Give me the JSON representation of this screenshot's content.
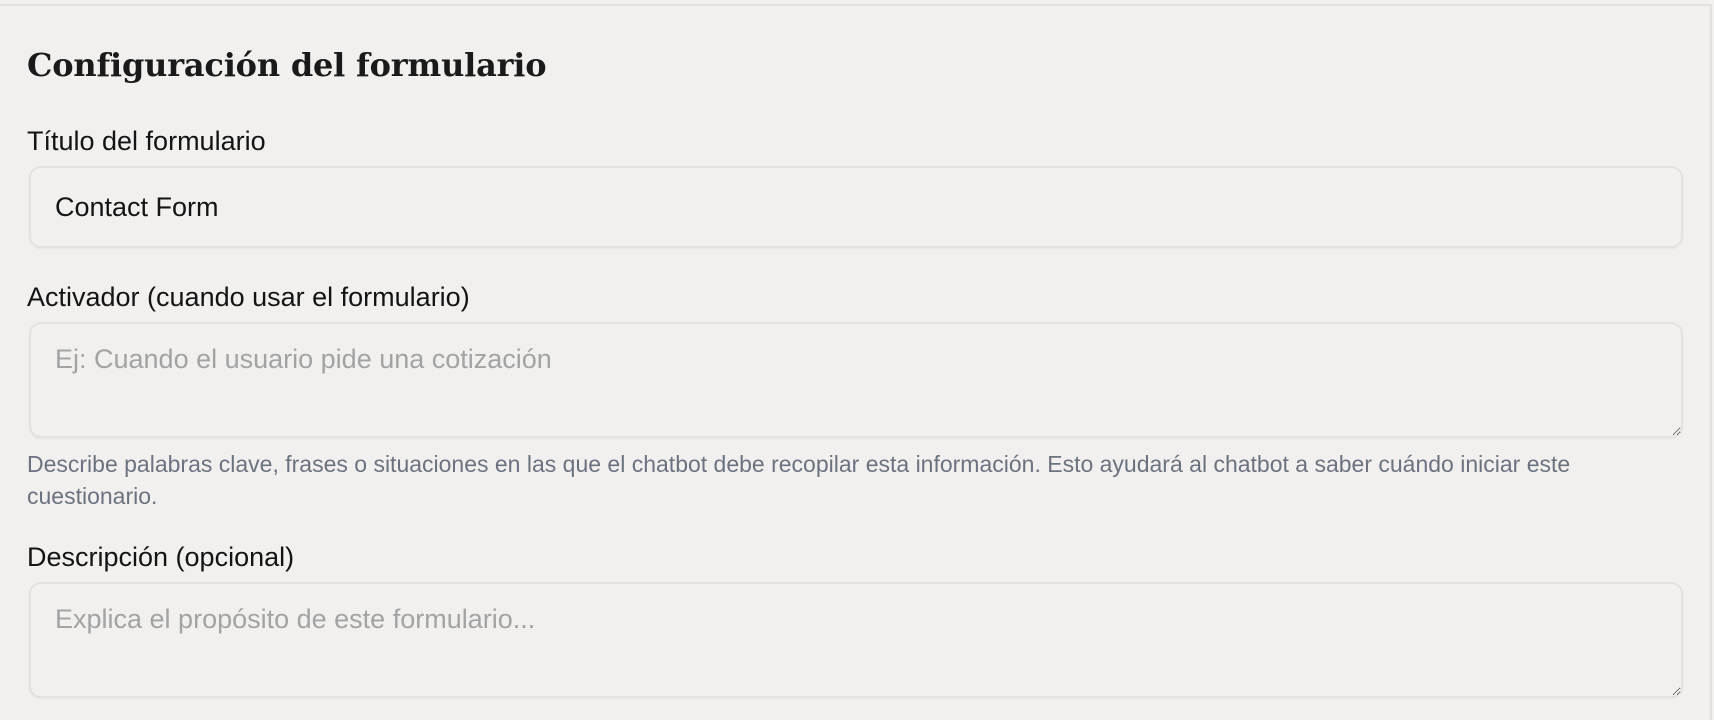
{
  "form_settings": {
    "heading": "Configuración del formulario",
    "title_field": {
      "label": "Título del formulario",
      "value": "Contact Form"
    },
    "trigger_field": {
      "label": "Activador (cuando usar el formulario)",
      "placeholder": "Ej: Cuando el usuario pide una cotización",
      "value": "",
      "help": "Describe palabras clave, frases o situaciones en las que el chatbot debe recopilar esta información. Esto ayudará al chatbot a saber cuándo iniciar este cuestionario."
    },
    "description_field": {
      "label": "Descripción (opcional)",
      "placeholder": "Explica el propósito de este formulario...",
      "value": ""
    }
  }
}
